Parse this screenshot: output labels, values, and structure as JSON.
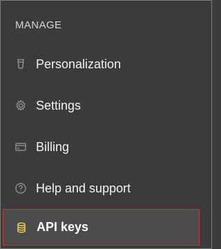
{
  "menu": {
    "section_label": "MANAGE",
    "items": [
      {
        "label": "Personalization",
        "icon": "paint-bucket-icon"
      },
      {
        "label": "Settings",
        "icon": "gear-icon"
      },
      {
        "label": "Billing",
        "icon": "credit-card-icon"
      },
      {
        "label": "Help and support",
        "icon": "question-circle-icon"
      },
      {
        "label": "API keys",
        "icon": "database-icon",
        "selected": true
      }
    ]
  },
  "colors": {
    "background": "#3a3b3d",
    "selected_background": "#4a4b4d",
    "selected_border": "#c8383e",
    "text": "#f3f3f3",
    "muted_icon": "#8e8f91",
    "api_icon": "#f2c94c"
  }
}
